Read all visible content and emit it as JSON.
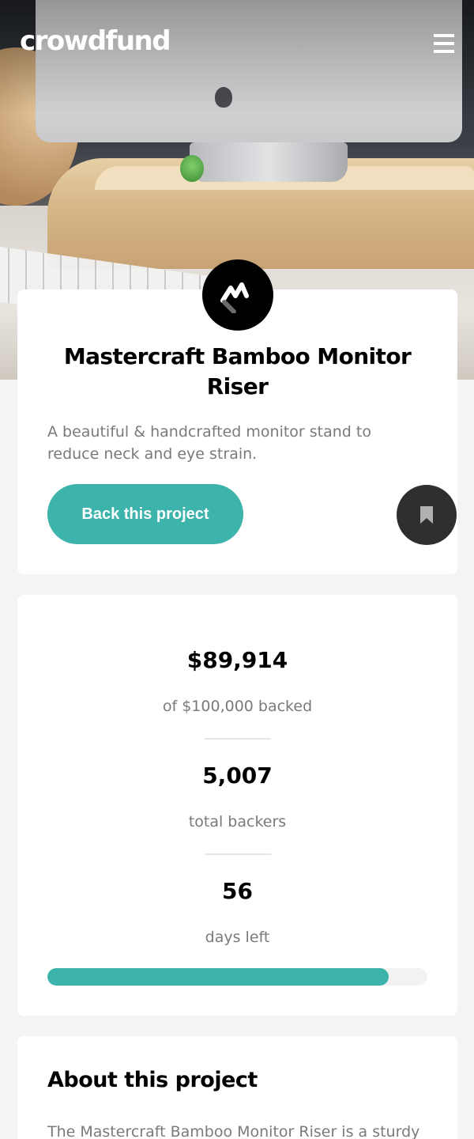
{
  "header": {
    "logo_text": "crowdfund",
    "menu_icon": "hamburger-menu-icon"
  },
  "hero": {
    "image_description_icon": "monitor-riser-photo"
  },
  "project": {
    "logo_icon": "mastercraft-logo-icon",
    "title": "Mastercraft Bamboo Monitor Riser",
    "subtitle": "A beautiful & handcrafted monitor stand to reduce neck and eye strain.",
    "back_button_label": "Back this project",
    "bookmark_icon": "bookmark-icon"
  },
  "stats": {
    "amount": "$89,914",
    "amount_label": "of $100,000 backed",
    "backers": "5,007",
    "backers_label": "total backers",
    "days": "56",
    "days_label": "days left",
    "progress_fraction": 0.89914
  },
  "about": {
    "title": "About this project",
    "text": "The Mastercraft Bamboo Monitor Riser is a sturdy"
  },
  "colors": {
    "accent": "#3cb3ab",
    "dark": "#2f2f2f",
    "background": "#f4f4f4"
  }
}
